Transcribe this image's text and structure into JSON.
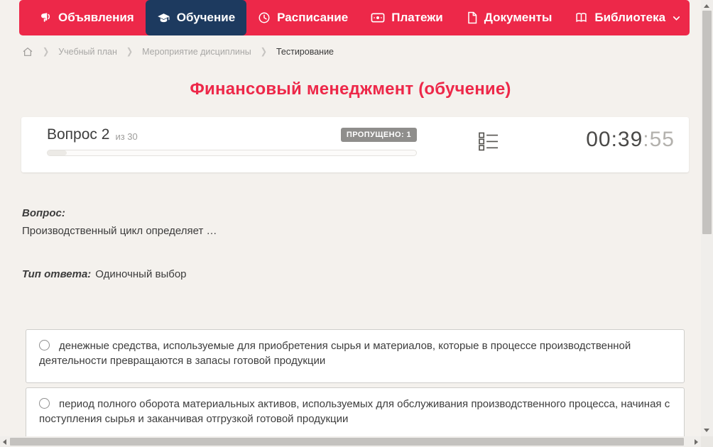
{
  "colors": {
    "nav_background": "#ed2849",
    "nav_active_background": "#1d3a5f",
    "page_background": "#f4f1ed",
    "title_color": "#ed2849",
    "badge_background": "#8f8e8c"
  },
  "nav": {
    "items": [
      {
        "label": "Объявления",
        "icon": "megaphone-icon"
      },
      {
        "label": "Обучение",
        "icon": "graduation-cap-icon",
        "active": true
      },
      {
        "label": "Расписание",
        "icon": "clock-icon"
      },
      {
        "label": "Платежи",
        "icon": "banknote-icon"
      },
      {
        "label": "Документы",
        "icon": "document-icon"
      },
      {
        "label": "Библиотека",
        "icon": "book-icon",
        "has_dropdown": true
      }
    ]
  },
  "breadcrumb": {
    "home_icon": "home-icon",
    "items": [
      {
        "label": "Учебный план"
      },
      {
        "label": "Мероприятие дисциплины"
      },
      {
        "label": "Тестирование",
        "current": true
      }
    ]
  },
  "page": {
    "title": "Финансовый менеджмент (обучение)"
  },
  "quiz": {
    "question_label": "Вопрос 2",
    "question_of": "из 30",
    "skipped_badge": "ПРОПУЩЕНО: 1",
    "question_list_icon": "question-list-icon",
    "timer_main": "00:39",
    "timer_seconds": ":55",
    "question_heading": "Вопрос:",
    "question_text": "Производственный цикл определяет …",
    "answer_type_label": "Тип ответа:",
    "answer_type_value": "Одиночный выбор",
    "options": [
      {
        "text": "денежные средства, используемые для приобретения сырья и материалов, которые в процессе производственной деятельности превращаются в запасы готовой продукции"
      },
      {
        "text": "период полного оборота материальных активов, используемых для обслуживания производственного процесса, начиная с поступления сырья и заканчивая отгрузкой готовой продукции"
      }
    ]
  }
}
